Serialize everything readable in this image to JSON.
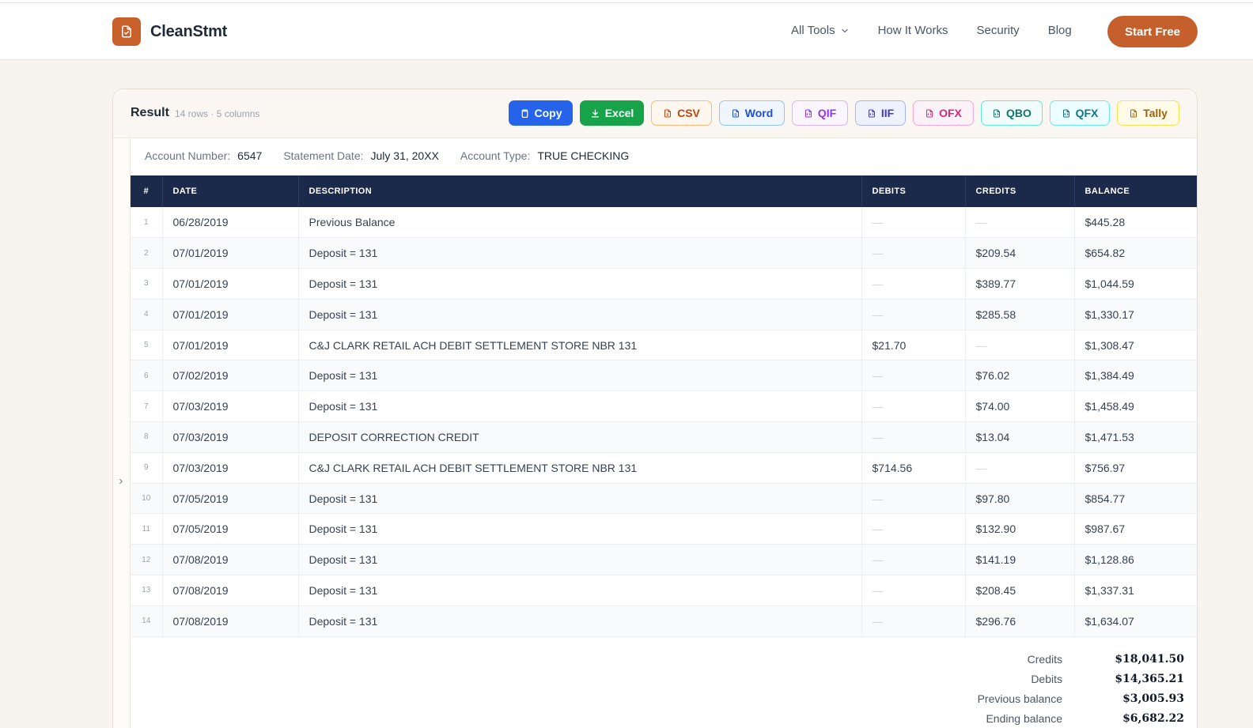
{
  "app": {
    "name": "CleanStmt",
    "brand_color": "#c55f2c"
  },
  "nav": {
    "items": [
      {
        "label": "All Tools",
        "has_dropdown": true
      },
      {
        "label": "How It Works"
      },
      {
        "label": "Security"
      },
      {
        "label": "Blog"
      }
    ],
    "cta": "Start Free"
  },
  "result": {
    "title": "Result",
    "meta": "14 rows · 5 columns",
    "export_buttons": [
      {
        "label": "Copy",
        "icon": "clipboard-icon"
      },
      {
        "label": "Excel",
        "icon": "download-icon"
      },
      {
        "label": "CSV",
        "icon": "file-icon"
      },
      {
        "label": "Word",
        "icon": "file-text-icon"
      },
      {
        "label": "QIF",
        "icon": "file-export-icon"
      },
      {
        "label": "IIF",
        "icon": "file-export-icon"
      },
      {
        "label": "OFX",
        "icon": "file-export-icon"
      },
      {
        "label": "QBO",
        "icon": "file-export-icon"
      },
      {
        "label": "QFX",
        "icon": "file-export-icon"
      },
      {
        "label": "Tally",
        "icon": "file-text-icon"
      }
    ]
  },
  "account": {
    "number_label": "Account Number:",
    "number": "6547",
    "date_label": "Statement Date:",
    "date": "July 31, 20XX",
    "type_label": "Account Type:",
    "type": "TRUE CHECKING"
  },
  "table": {
    "headers": [
      "#",
      "DATE",
      "DESCRIPTION",
      "DEBITS",
      "CREDITS",
      "BALANCE"
    ],
    "rows": [
      [
        "1",
        "06/28/2019",
        "Previous Balance",
        "—",
        "—",
        "$445.28"
      ],
      [
        "2",
        "07/01/2019",
        "Deposit = 131",
        "—",
        "$209.54",
        "$654.82"
      ],
      [
        "3",
        "07/01/2019",
        "Deposit = 131",
        "—",
        "$389.77",
        "$1,044.59"
      ],
      [
        "4",
        "07/01/2019",
        "Deposit = 131",
        "—",
        "$285.58",
        "$1,330.17"
      ],
      [
        "5",
        "07/01/2019",
        "C&J CLARK RETAIL ACH DEBIT SETTLEMENT STORE NBR 131",
        "$21.70",
        "—",
        "$1,308.47"
      ],
      [
        "6",
        "07/02/2019",
        "Deposit = 131",
        "—",
        "$76.02",
        "$1,384.49"
      ],
      [
        "7",
        "07/03/2019",
        "Deposit = 131",
        "—",
        "$74.00",
        "$1,458.49"
      ],
      [
        "8",
        "07/03/2019",
        "DEPOSIT CORRECTION CREDIT",
        "—",
        "$13.04",
        "$1,471.53"
      ],
      [
        "9",
        "07/03/2019",
        "C&J CLARK RETAIL ACH DEBIT SETTLEMENT STORE NBR 131",
        "$714.56",
        "—",
        "$756.97"
      ],
      [
        "10",
        "07/05/2019",
        "Deposit = 131",
        "—",
        "$97.80",
        "$854.77"
      ],
      [
        "11",
        "07/05/2019",
        "Deposit = 131",
        "—",
        "$132.90",
        "$987.67"
      ],
      [
        "12",
        "07/08/2019",
        "Deposit = 131",
        "—",
        "$141.19",
        "$1,128.86"
      ],
      [
        "13",
        "07/08/2019",
        "Deposit = 131",
        "—",
        "$208.45",
        "$1,337.31"
      ],
      [
        "14",
        "07/08/2019",
        "Deposit = 131",
        "—",
        "$296.76",
        "$1,634.07"
      ]
    ]
  },
  "totals": [
    {
      "label": "Credits",
      "value": "$18,041.50"
    },
    {
      "label": "Debits",
      "value": "$14,365.21"
    },
    {
      "label": "Previous balance",
      "value": "$3,005.93"
    },
    {
      "label": "Ending balance",
      "value": "$6,682.22"
    }
  ]
}
